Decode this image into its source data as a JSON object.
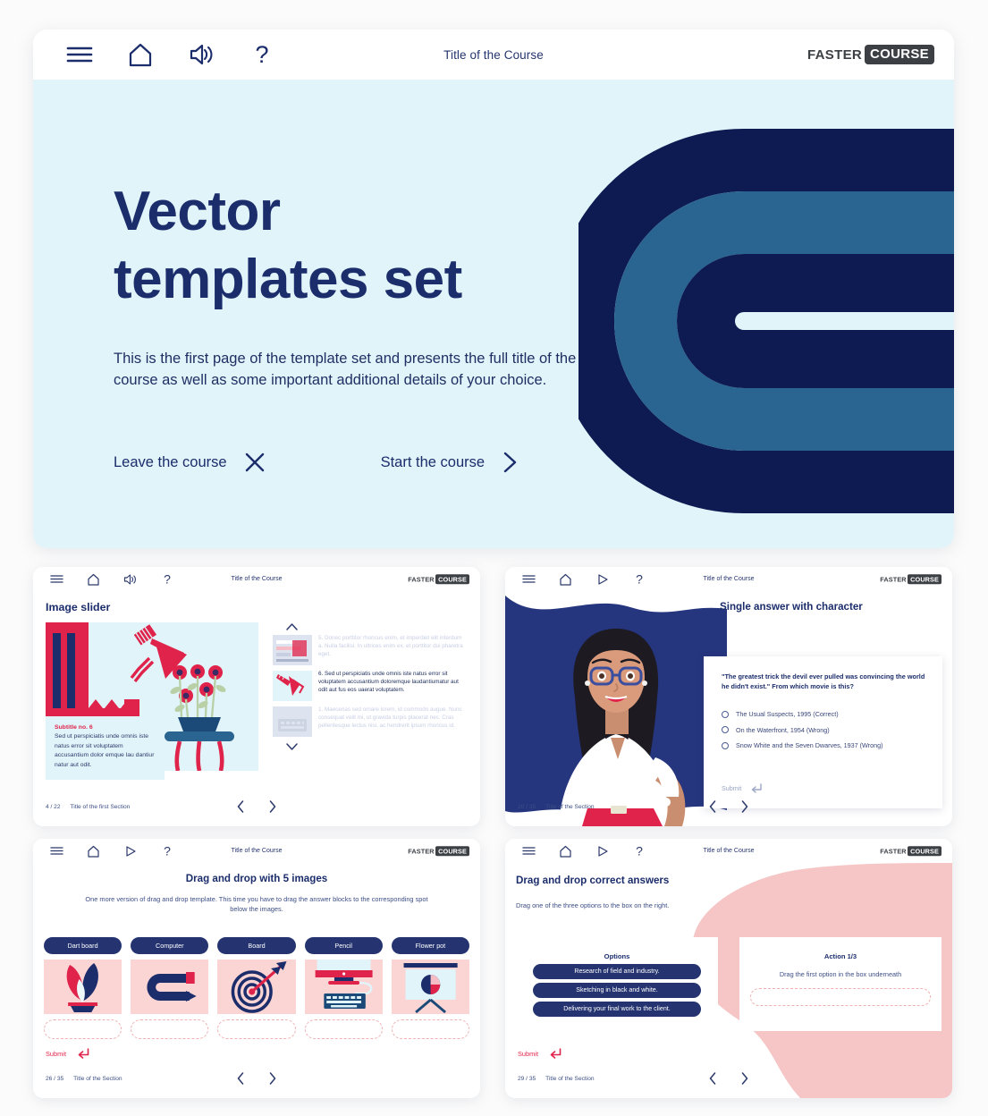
{
  "hero": {
    "topbar": {
      "menu_icon": "hamburger-menu-icon",
      "home_icon": "home-icon",
      "sound_icon": "speaker-icon",
      "help_icon": "question-mark-icon",
      "course_title": "Title of the Course",
      "logo_part1": "FASTER",
      "logo_part2": "COURSE"
    },
    "title_line1": "Vector",
    "title_line2": "templates set",
    "paragraph": "This is the first page of the template set and presents the full title of the course as well as some important additional details of your choice.",
    "leave_label": "Leave the course",
    "start_label": "Start the course",
    "colors": {
      "background": "#e1f4fa",
      "navy": "#0d1b52",
      "mid_blue": "#2a6490",
      "title_navy": "#1b2d6b"
    }
  },
  "cards": [
    {
      "id": "image-slider",
      "topbar": {
        "course_title": "Title of the Course",
        "media_icon": "speaker-icon",
        "logo_part1": "FASTER",
        "logo_part2": "COURSE"
      },
      "title": "Image slider",
      "caption_title": "Subtitle no. 6",
      "caption_body": "Sed ut perspiciatis unde omnis iste natus error sit voluptatem accusantium dolor emque lau dantiur natur aut odit.",
      "items": [
        {
          "text": "5. Donec porttitor rhoncus enim, et imperdiet elit interdum a. Nulla facilisi. In ultrices enim ex, et porttitor dui pharetra eget.",
          "active": false
        },
        {
          "text": "6. Sed ut perspiciatis unde omnis iste natus error sit voluptatem accusantium doloremque laudantiumatur aut odit aut fus eos uaerat voluptatem.",
          "active": true
        },
        {
          "text": "1. Maecenas sed ornare lorem, id commodo augue. Nunc consequat velit mi, ut gravida turpis placerat nec. Cras pellentesque lectus nisi, ac hendrerit ipsum rhoncus id.",
          "active": false
        }
      ],
      "footer": {
        "page": "4 / 22",
        "section": "Title of the first Section"
      }
    },
    {
      "id": "single-answer-with-character",
      "topbar": {
        "course_title": "Title of the Course",
        "media_icon": "play-icon",
        "logo_part1": "FASTER",
        "logo_part2": "COURSE"
      },
      "title": "Single answer with character",
      "question": "\"The greatest trick the devil ever pulled was convincing the world he didn't exist.\" From which movie is this?",
      "options": [
        "The Usual Suspects, 1995 (Correct)",
        "On the Waterfront, 1954 (Wrong)",
        "Snow White and the Seven Dwarves, 1937 (Wrong)"
      ],
      "submit_label": "Submit",
      "footer": {
        "page": "20 / 35",
        "section": "Title of the Section"
      }
    },
    {
      "id": "drag-and-drop-with-5-images",
      "topbar": {
        "course_title": "Title of the Course",
        "media_icon": "play-icon",
        "logo_part1": "FASTER",
        "logo_part2": "COURSE"
      },
      "title": "Drag and drop with 5 images",
      "description": "One more version of drag and drop template. This time you have to drag the answer blocks to the corresponding spot below the images.",
      "pills": [
        "Dart board",
        "Computer",
        "Board",
        "Pencil",
        "Flower pot"
      ],
      "thumbs": [
        "flower-pot-illustration",
        "magnet-illustration",
        "dartboard-illustration",
        "computer-keyboard-illustration",
        "presentation-board-illustration"
      ],
      "submit_label": "Submit",
      "footer": {
        "page": "26 / 35",
        "section": "Title of the Section"
      }
    },
    {
      "id": "drag-and-drop-correct-answers",
      "topbar": {
        "course_title": "Title of the Course",
        "media_icon": "play-icon",
        "logo_part1": "FASTER",
        "logo_part2": "COURSE"
      },
      "title": "Drag and drop correct answers",
      "description": "Drag one of the three options to the box on the right.",
      "options_heading": "Options",
      "options": [
        "Research of field and industry.",
        "Sketching in black and white.",
        "Delivering your final work to the client."
      ],
      "action_heading": "Action 1/3",
      "action_sub": "Drag the first option in the box underneath",
      "submit_label": "Submit",
      "footer": {
        "page": "29 / 35",
        "section": "Title of the Section"
      }
    }
  ]
}
